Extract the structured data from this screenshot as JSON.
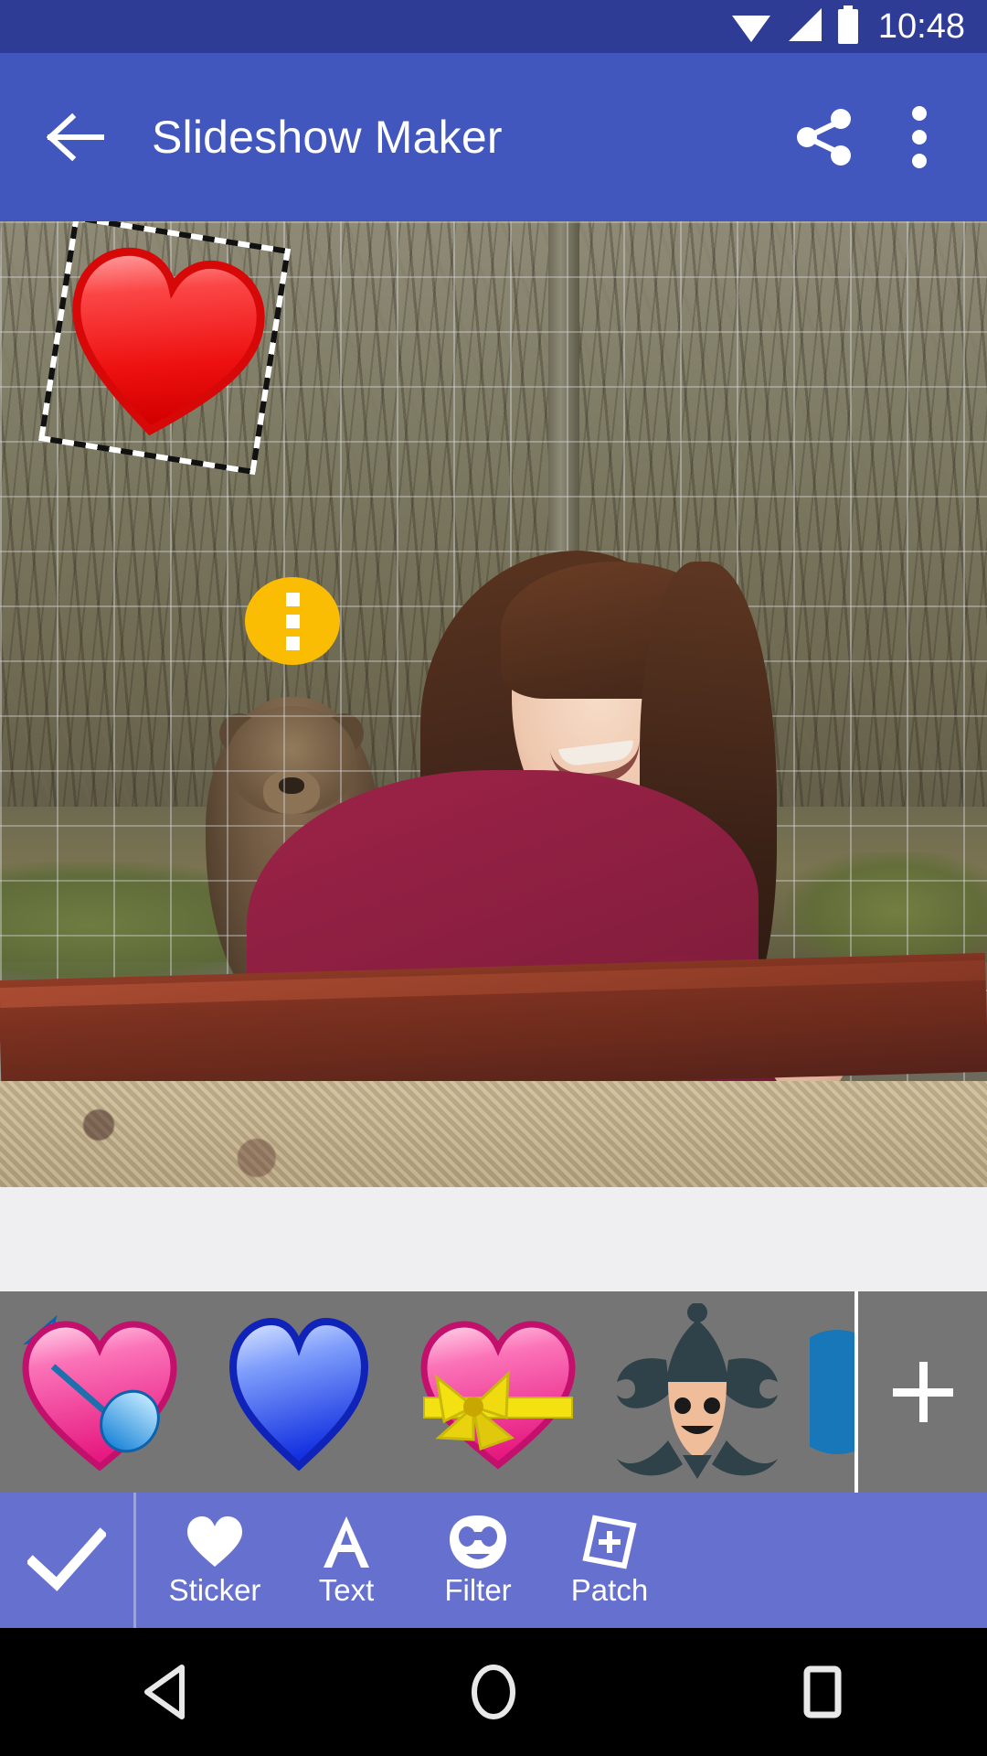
{
  "status_bar": {
    "time": "10:48",
    "icons": [
      "wifi-icon",
      "cellular-signal-icon",
      "battery-icon"
    ],
    "background_color": "#2E3C96"
  },
  "app_bar": {
    "title": "Slideshow Maker",
    "back_icon": "back-arrow-icon",
    "share_icon": "share-icon",
    "overflow_icon": "overflow-menu-icon",
    "background_color": "#4257BD"
  },
  "canvas": {
    "description": "Photo of a smiling girl with long brown hair in a maroon hoodie standing in front of a wire fence with a brown bear behind it",
    "placed_sticker": {
      "name": "red-heart-sticker",
      "selected": true,
      "rotation_degrees": 9
    },
    "sticker_menu_button": {
      "icon": "vertical-dots-icon",
      "color": "#FBBC04"
    }
  },
  "sticker_tray": {
    "background_color": "#757575",
    "items": [
      {
        "name": "heart-with-arrow-sticker",
        "label": "Heart with arrow"
      },
      {
        "name": "blue-heart-sticker",
        "label": "Blue heart"
      },
      {
        "name": "heart-with-ribbon-sticker",
        "label": "Heart with ribbon"
      },
      {
        "name": "jester-face-sticker",
        "label": "Jester face"
      },
      {
        "name": "partial-blue-sticker",
        "label": "Blue sticker"
      }
    ],
    "add_button": {
      "name": "add-sticker-button",
      "icon": "plus-icon"
    }
  },
  "bottom_toolbar": {
    "background_color": "#6670CF",
    "confirm": {
      "name": "confirm-button",
      "icon": "checkmark-icon"
    },
    "tools": [
      {
        "label": "Sticker",
        "icon": "heart-icon",
        "selected": true
      },
      {
        "label": "Text",
        "icon": "letter-a-icon",
        "selected": false
      },
      {
        "label": "Filter",
        "icon": "mask-icon",
        "selected": false
      },
      {
        "label": "Patch",
        "icon": "patch-plus-icon",
        "selected": false
      }
    ]
  },
  "nav_bar": {
    "background_color": "#000000",
    "buttons": [
      {
        "name": "android-back-button",
        "icon": "triangle-left-icon"
      },
      {
        "name": "android-home-button",
        "icon": "circle-icon"
      },
      {
        "name": "android-recents-button",
        "icon": "square-icon"
      }
    ]
  }
}
